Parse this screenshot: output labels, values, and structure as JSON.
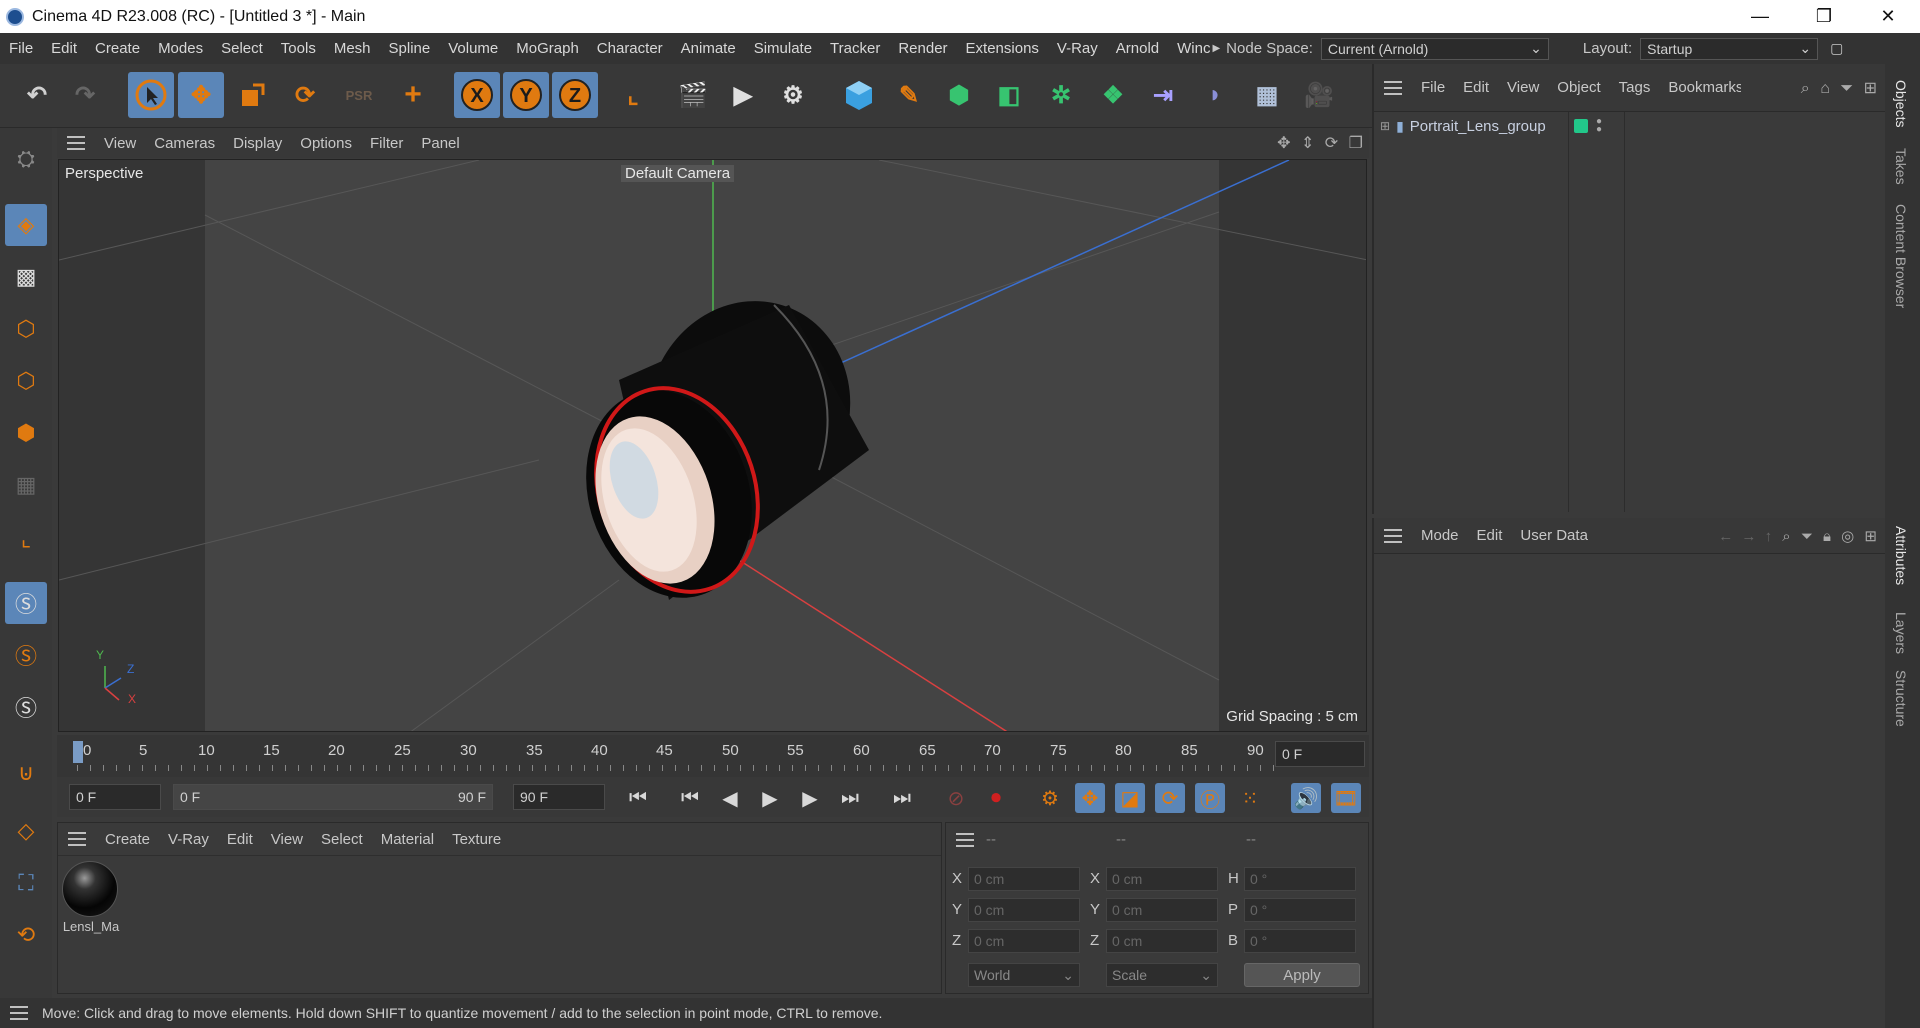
{
  "window": {
    "title": "Cinema 4D R23.008 (RC) - [Untitled 3 *] - Main",
    "minimize": "—",
    "maximize": "❐",
    "close": "✕"
  },
  "menubar": {
    "items": [
      "File",
      "Edit",
      "Create",
      "Modes",
      "Select",
      "Tools",
      "Mesh",
      "Spline",
      "Volume",
      "MoGraph",
      "Character",
      "Animate",
      "Simulate",
      "Tracker",
      "Render",
      "Extensions",
      "V-Ray",
      "Arnold",
      "Winc"
    ],
    "node_space_label": "Node Space:",
    "node_space_value": "Current (Arnold)",
    "layout_label": "Layout:",
    "layout_value": "Startup"
  },
  "viewport": {
    "menu": [
      "View",
      "Cameras",
      "Display",
      "Options",
      "Filter",
      "Panel"
    ],
    "projection": "Perspective",
    "camera": "Default Camera",
    "grid_spacing": "Grid Spacing : 5 cm",
    "axis_labels": {
      "x": "X",
      "y": "Y",
      "z": "Z"
    }
  },
  "timeline": {
    "ticks": [
      "0",
      "5",
      "10",
      "15",
      "20",
      "25",
      "30",
      "35",
      "40",
      "45",
      "50",
      "55",
      "60",
      "65",
      "70",
      "75",
      "80",
      "85",
      "90"
    ],
    "current_frame": "0 F"
  },
  "playbar": {
    "start_field": "0 F",
    "range_start": "0 F",
    "range_end": "90 F",
    "end_field": "90 F"
  },
  "material_manager": {
    "menu": [
      "Create",
      "V-Ray",
      "Edit",
      "View",
      "Select",
      "Material",
      "Texture"
    ],
    "materials": [
      {
        "name": "Lensl_Ma"
      }
    ]
  },
  "coordinates": {
    "headers": [
      "--",
      "--",
      "--"
    ],
    "pos": [
      {
        "label": "X",
        "value": "0 cm"
      },
      {
        "label": "Y",
        "value": "0 cm"
      },
      {
        "label": "Z",
        "value": "0 cm"
      }
    ],
    "size": [
      {
        "label": "X",
        "value": "0 cm"
      },
      {
        "label": "Y",
        "value": "0 cm"
      },
      {
        "label": "Z",
        "value": "0 cm"
      }
    ],
    "rot": [
      {
        "label": "H",
        "value": "0 °"
      },
      {
        "label": "P",
        "value": "0 °"
      },
      {
        "label": "B",
        "value": "0 °"
      }
    ],
    "space": "World",
    "mode": "Scale",
    "apply": "Apply"
  },
  "object_manager": {
    "menu": [
      "File",
      "Edit",
      "View",
      "Object",
      "Tags",
      "Bookmarks"
    ],
    "objects": [
      {
        "name": "Portrait_Lens_group"
      }
    ]
  },
  "attribute_manager": {
    "menu": [
      "Mode",
      "Edit",
      "User Data"
    ]
  },
  "side_tabs": {
    "top": [
      "Objects",
      "Takes",
      "Content Browser"
    ],
    "bottom": [
      "Attributes",
      "Layers",
      "Structure"
    ]
  },
  "status": "Move: Click and drag to move elements. Hold down SHIFT to quantize movement / add to the selection in point mode, CTRL to remove.",
  "colors": {
    "accent": "#5b86b8",
    "axis_x": "#d94040",
    "axis_y": "#4fb84f",
    "axis_z": "#3a6fd1",
    "lens_ring": "#d01818",
    "object_tag": "#22c88a"
  }
}
